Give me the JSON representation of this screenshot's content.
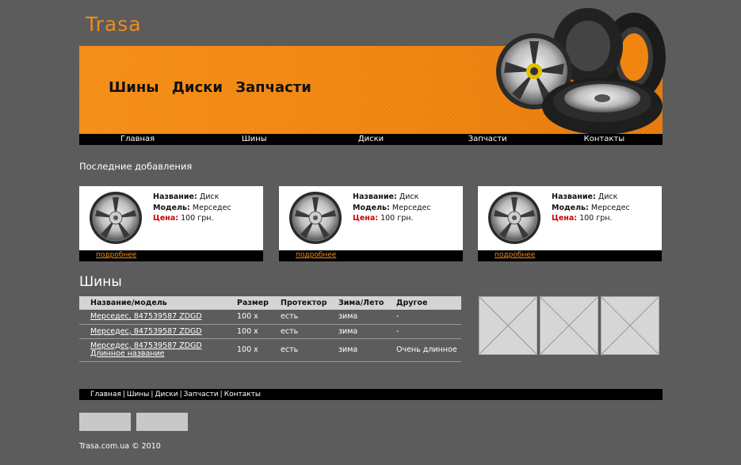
{
  "site": {
    "logo": "Trasa"
  },
  "banner": {
    "title": "Шины  Диски  Запчасти"
  },
  "nav": {
    "items": [
      {
        "label": "Главная"
      },
      {
        "label": "Шины"
      },
      {
        "label": "Диски"
      },
      {
        "label": "Запчасти"
      },
      {
        "label": "Контакты"
      }
    ]
  },
  "latest": {
    "heading": "Последние добавления",
    "cards": [
      {
        "name_label": "Название:",
        "name": "Диск",
        "model_label": "Модель:",
        "model": "Мерседес",
        "price_label": "Цена:",
        "price": "100 грн.",
        "more": "подробнее"
      },
      {
        "name_label": "Название:",
        "name": "Диск",
        "model_label": "Модель:",
        "model": "Мерседес",
        "price_label": "Цена:",
        "price": "100 грн.",
        "more": "подробнее"
      },
      {
        "name_label": "Название:",
        "name": "Диск",
        "model_label": "Модель:",
        "model": "Мерседес",
        "price_label": "Цена:",
        "price": "100 грн.",
        "more": "подробнее"
      }
    ]
  },
  "tires": {
    "heading": "Шины",
    "columns": [
      "Название/модель",
      "Размер",
      "Протектор",
      "Зима/Лето",
      "Другое"
    ],
    "rows": [
      {
        "name": "Мерседес, 847539587 ZDGD",
        "size": "100 x",
        "tread": "есть",
        "season": "зима",
        "other": "-"
      },
      {
        "name": "Мерседес, 847539587 ZDGD",
        "size": "100 x",
        "tread": "есть",
        "season": "зима",
        "other": "-"
      },
      {
        "name": "Мерседес, 847539587 ZDGD Длинное название",
        "size": "100 x",
        "tread": "есть",
        "season": "зима",
        "other": "Очень длинное"
      }
    ]
  },
  "footer": {
    "links": [
      "Главная",
      "Шины",
      "Диски",
      "Запчасти",
      "Контакты"
    ],
    "separator": "|",
    "copyright": "Trasa.com.ua © 2010"
  },
  "colors": {
    "accent": "#f08a1c",
    "background": "#5c5c5c",
    "bar": "#000000",
    "price": "#cc0000"
  }
}
